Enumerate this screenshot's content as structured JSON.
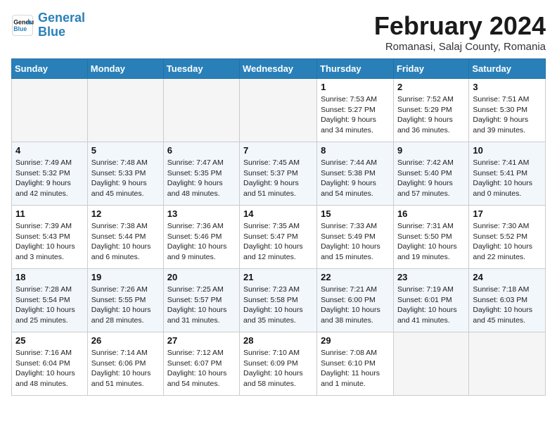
{
  "header": {
    "logo_line1": "General",
    "logo_line2": "Blue",
    "month": "February 2024",
    "location": "Romanasi, Salaj County, Romania"
  },
  "days_of_week": [
    "Sunday",
    "Monday",
    "Tuesday",
    "Wednesday",
    "Thursday",
    "Friday",
    "Saturday"
  ],
  "weeks": [
    [
      {
        "day": "",
        "empty": true
      },
      {
        "day": "",
        "empty": true
      },
      {
        "day": "",
        "empty": true
      },
      {
        "day": "",
        "empty": true
      },
      {
        "day": "1",
        "sunrise": "7:53 AM",
        "sunset": "5:27 PM",
        "daylight": "9 hours and 34 minutes."
      },
      {
        "day": "2",
        "sunrise": "7:52 AM",
        "sunset": "5:29 PM",
        "daylight": "9 hours and 36 minutes."
      },
      {
        "day": "3",
        "sunrise": "7:51 AM",
        "sunset": "5:30 PM",
        "daylight": "9 hours and 39 minutes."
      }
    ],
    [
      {
        "day": "4",
        "sunrise": "7:49 AM",
        "sunset": "5:32 PM",
        "daylight": "9 hours and 42 minutes."
      },
      {
        "day": "5",
        "sunrise": "7:48 AM",
        "sunset": "5:33 PM",
        "daylight": "9 hours and 45 minutes."
      },
      {
        "day": "6",
        "sunrise": "7:47 AM",
        "sunset": "5:35 PM",
        "daylight": "9 hours and 48 minutes."
      },
      {
        "day": "7",
        "sunrise": "7:45 AM",
        "sunset": "5:37 PM",
        "daylight": "9 hours and 51 minutes."
      },
      {
        "day": "8",
        "sunrise": "7:44 AM",
        "sunset": "5:38 PM",
        "daylight": "9 hours and 54 minutes."
      },
      {
        "day": "9",
        "sunrise": "7:42 AM",
        "sunset": "5:40 PM",
        "daylight": "9 hours and 57 minutes."
      },
      {
        "day": "10",
        "sunrise": "7:41 AM",
        "sunset": "5:41 PM",
        "daylight": "10 hours and 0 minutes."
      }
    ],
    [
      {
        "day": "11",
        "sunrise": "7:39 AM",
        "sunset": "5:43 PM",
        "daylight": "10 hours and 3 minutes."
      },
      {
        "day": "12",
        "sunrise": "7:38 AM",
        "sunset": "5:44 PM",
        "daylight": "10 hours and 6 minutes."
      },
      {
        "day": "13",
        "sunrise": "7:36 AM",
        "sunset": "5:46 PM",
        "daylight": "10 hours and 9 minutes."
      },
      {
        "day": "14",
        "sunrise": "7:35 AM",
        "sunset": "5:47 PM",
        "daylight": "10 hours and 12 minutes."
      },
      {
        "day": "15",
        "sunrise": "7:33 AM",
        "sunset": "5:49 PM",
        "daylight": "10 hours and 15 minutes."
      },
      {
        "day": "16",
        "sunrise": "7:31 AM",
        "sunset": "5:50 PM",
        "daylight": "10 hours and 19 minutes."
      },
      {
        "day": "17",
        "sunrise": "7:30 AM",
        "sunset": "5:52 PM",
        "daylight": "10 hours and 22 minutes."
      }
    ],
    [
      {
        "day": "18",
        "sunrise": "7:28 AM",
        "sunset": "5:54 PM",
        "daylight": "10 hours and 25 minutes."
      },
      {
        "day": "19",
        "sunrise": "7:26 AM",
        "sunset": "5:55 PM",
        "daylight": "10 hours and 28 minutes."
      },
      {
        "day": "20",
        "sunrise": "7:25 AM",
        "sunset": "5:57 PM",
        "daylight": "10 hours and 31 minutes."
      },
      {
        "day": "21",
        "sunrise": "7:23 AM",
        "sunset": "5:58 PM",
        "daylight": "10 hours and 35 minutes."
      },
      {
        "day": "22",
        "sunrise": "7:21 AM",
        "sunset": "6:00 PM",
        "daylight": "10 hours and 38 minutes."
      },
      {
        "day": "23",
        "sunrise": "7:19 AM",
        "sunset": "6:01 PM",
        "daylight": "10 hours and 41 minutes."
      },
      {
        "day": "24",
        "sunrise": "7:18 AM",
        "sunset": "6:03 PM",
        "daylight": "10 hours and 45 minutes."
      }
    ],
    [
      {
        "day": "25",
        "sunrise": "7:16 AM",
        "sunset": "6:04 PM",
        "daylight": "10 hours and 48 minutes."
      },
      {
        "day": "26",
        "sunrise": "7:14 AM",
        "sunset": "6:06 PM",
        "daylight": "10 hours and 51 minutes."
      },
      {
        "day": "27",
        "sunrise": "7:12 AM",
        "sunset": "6:07 PM",
        "daylight": "10 hours and 54 minutes."
      },
      {
        "day": "28",
        "sunrise": "7:10 AM",
        "sunset": "6:09 PM",
        "daylight": "10 hours and 58 minutes."
      },
      {
        "day": "29",
        "sunrise": "7:08 AM",
        "sunset": "6:10 PM",
        "daylight": "11 hours and 1 minute."
      },
      {
        "day": "",
        "empty": true
      },
      {
        "day": "",
        "empty": true
      }
    ]
  ],
  "labels": {
    "sunrise": "Sunrise:",
    "sunset": "Sunset:",
    "daylight": "Daylight hours"
  }
}
